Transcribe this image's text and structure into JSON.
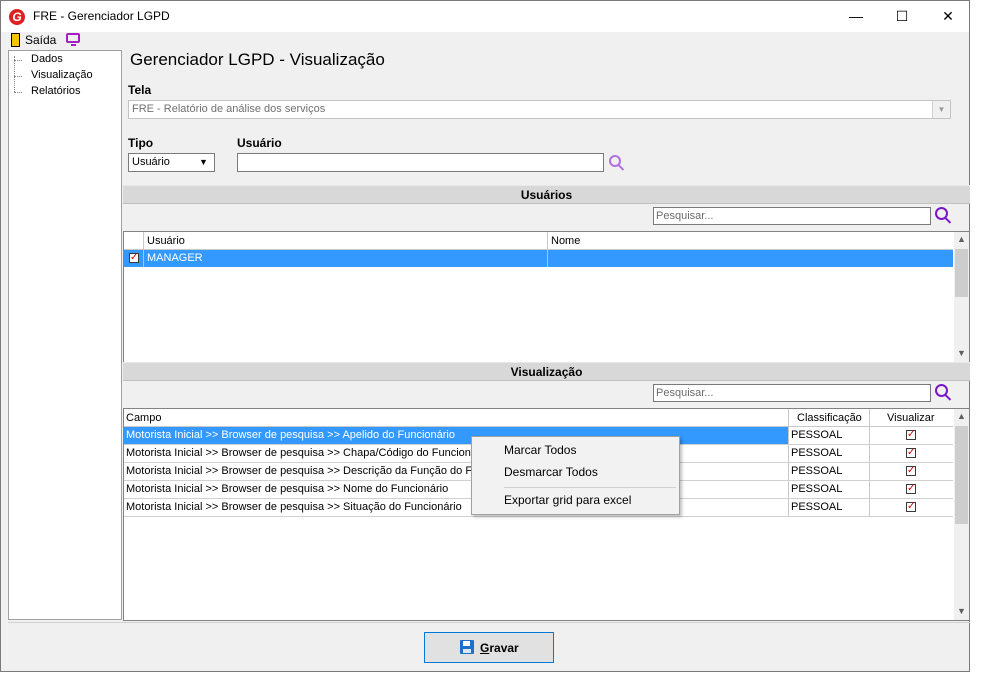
{
  "window": {
    "title": "FRE - Gerenciador LGPD",
    "logo_letter": "G",
    "controls": {
      "minimize": "—",
      "maximize": "☐",
      "close": "✕"
    }
  },
  "toolbar": {
    "exit_label": "Saída"
  },
  "tree": {
    "items": [
      "Dados",
      "Visualização",
      "Relatórios"
    ]
  },
  "main": {
    "title": "Gerenciador LGPD - Visualização",
    "tela_label": "Tela",
    "tela_value": "FRE - Relatório de análise dos serviços",
    "tipo_label": "Tipo",
    "tipo_value": "Usuário",
    "usuario_label": "Usuário",
    "usuario_value": ""
  },
  "usuarios": {
    "header": "Usuários",
    "search_placeholder": "Pesquisar...",
    "columns": [
      "Usuário",
      "Nome"
    ],
    "rows": [
      {
        "usuario": "MANAGER",
        "nome": "",
        "checked": true
      }
    ]
  },
  "visualizacao": {
    "header": "Visualização",
    "search_placeholder": "Pesquisar...",
    "columns": [
      "Campo",
      "Classificação",
      "Visualizar"
    ],
    "rows": [
      {
        "campo": "Motorista Inicial >> Browser de pesquisa >> Apelido do Funcionário",
        "classificacao": "PESSOAL",
        "visualizar": true
      },
      {
        "campo": "Motorista Inicial >> Browser de pesquisa >> Chapa/Código do Funcionário",
        "classificacao": "PESSOAL",
        "visualizar": true
      },
      {
        "campo": "Motorista Inicial >> Browser de pesquisa >> Descrição da Função do Funcionário",
        "classificacao": "PESSOAL",
        "visualizar": true
      },
      {
        "campo": "Motorista Inicial >> Browser de pesquisa >> Nome do Funcionário",
        "classificacao": "PESSOAL",
        "visualizar": true
      },
      {
        "campo": "Motorista Inicial >> Browser de pesquisa >> Situação do Funcionário",
        "classificacao": "PESSOAL",
        "visualizar": true
      }
    ]
  },
  "context_menu": {
    "items": [
      "Marcar Todos",
      "Desmarcar Todos",
      "Exportar grid para excel"
    ]
  },
  "footer": {
    "save_underline": "G",
    "save_rest": "ravar"
  },
  "colors": {
    "accent": "#0078d7",
    "selection": "#3399ff",
    "search_icon": "#7a16c8",
    "usuario_search_icon": "#b070e0"
  }
}
